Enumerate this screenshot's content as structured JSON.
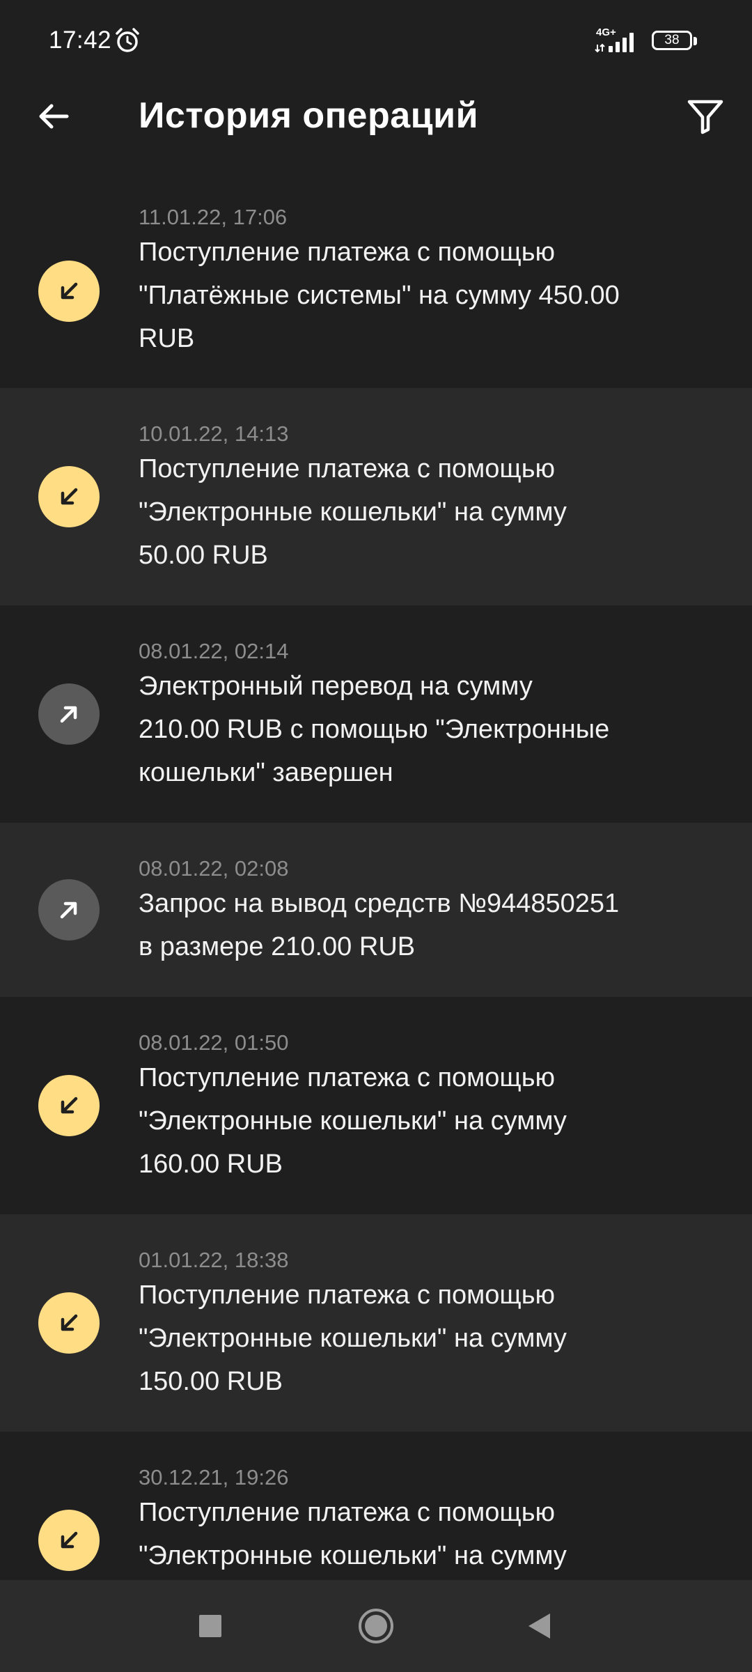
{
  "status_bar": {
    "time": "17:42",
    "network": "4G+",
    "battery": "38",
    "icons": [
      "alarm-icon",
      "signal-icon",
      "battery-icon"
    ]
  },
  "header": {
    "title": "История операций",
    "back_icon": "arrow-left-icon",
    "filter_icon": "filter-icon"
  },
  "operations": [
    {
      "type": "incoming",
      "icon": "arrow-down-left-icon",
      "date": "11.01.22, 17:06",
      "lines": [
        "Поступление платежа с помощью",
        "\"Платёжные системы\" на сумму 450.00",
        "RUB"
      ]
    },
    {
      "type": "incoming",
      "icon": "arrow-down-left-icon",
      "date": "10.01.22, 14:13",
      "lines": [
        "Поступление платежа с помощью",
        "\"Электронные кошельки\" на сумму",
        "50.00 RUB"
      ]
    },
    {
      "type": "outgoing",
      "icon": "arrow-up-right-icon",
      "date": "08.01.22, 02:14",
      "lines": [
        "Электронный перевод на сумму",
        "210.00 RUB с помощью \"Электронные",
        "кошельки\" завершен"
      ]
    },
    {
      "type": "outgoing",
      "icon": "arrow-up-right-icon",
      "date": "08.01.22, 02:08",
      "lines": [
        "Запрос на вывод средств №944850251",
        "в размере 210.00 RUB"
      ]
    },
    {
      "type": "incoming",
      "icon": "arrow-down-left-icon",
      "date": "08.01.22, 01:50",
      "lines": [
        "Поступление платежа с помощью",
        "\"Электронные кошельки\" на сумму",
        "160.00 RUB"
      ]
    },
    {
      "type": "incoming",
      "icon": "arrow-down-left-icon",
      "date": "01.01.22, 18:38",
      "lines": [
        "Поступление платежа с помощью",
        "\"Электронные кошельки\" на сумму",
        "150.00 RUB"
      ]
    },
    {
      "type": "incoming",
      "icon": "arrow-down-left-icon",
      "date": "30.12.21, 19:26",
      "lines": [
        "Поступление платежа с помощью",
        "\"Электронные кошельки\" на сумму"
      ]
    }
  ],
  "nav_bar": {
    "buttons": [
      "recents-square-icon",
      "home-circle-icon",
      "back-triangle-icon"
    ]
  },
  "colors": {
    "background": "#1f1f1f",
    "row_alt": "#2a2a2a",
    "incoming_icon_bg": "#ffdd85",
    "outgoing_icon_bg": "#5a5a5a",
    "date_text": "#8d8d8d",
    "nav_bar": "#2c2c2c"
  }
}
